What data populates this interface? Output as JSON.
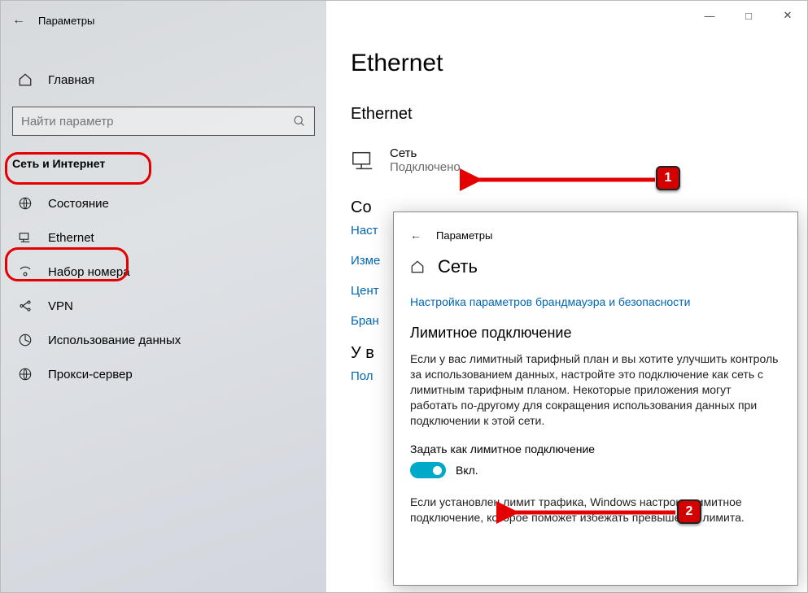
{
  "window": {
    "title": "Параметры"
  },
  "sidebar": {
    "home": "Главная",
    "search_placeholder": "Найти параметр",
    "section": "Сеть и Интернет",
    "items": [
      {
        "label": "Состояние"
      },
      {
        "label": "Ethernet"
      },
      {
        "label": "Набор номера"
      },
      {
        "label": "VPN"
      },
      {
        "label": "Использование данных"
      },
      {
        "label": "Прокси-сервер"
      }
    ]
  },
  "page": {
    "h1": "Ethernet",
    "h2": "Ethernet",
    "network": {
      "name": "Сеть",
      "status": "Подключено"
    },
    "related_h": "Со",
    "links": [
      "Наст",
      "Изме",
      "Цент",
      "Бран"
    ],
    "question_h": "У в",
    "question_link": "Пол"
  },
  "popup": {
    "title": "Параметры",
    "crumb": "Сеть",
    "firewall_link": "Настройка параметров брандмауэра и безопасности",
    "section_h": "Лимитное подключение",
    "desc": "Если у вас лимитный тарифный план и вы хотите улучшить контроль за использованием данных, настройте это подключение как сеть с лимитным тарифным планом. Некоторые приложения могут работать по-другому для сокращения использования данных при подключении к этой сети.",
    "toggle_label": "Задать как лимитное подключение",
    "toggle_state": "Вкл.",
    "note": "Если установлен лимит трафика, Windows настроит лимитное подключение, которое поможет избежать превышения лимита."
  },
  "annotations": {
    "one": "1",
    "two": "2"
  }
}
